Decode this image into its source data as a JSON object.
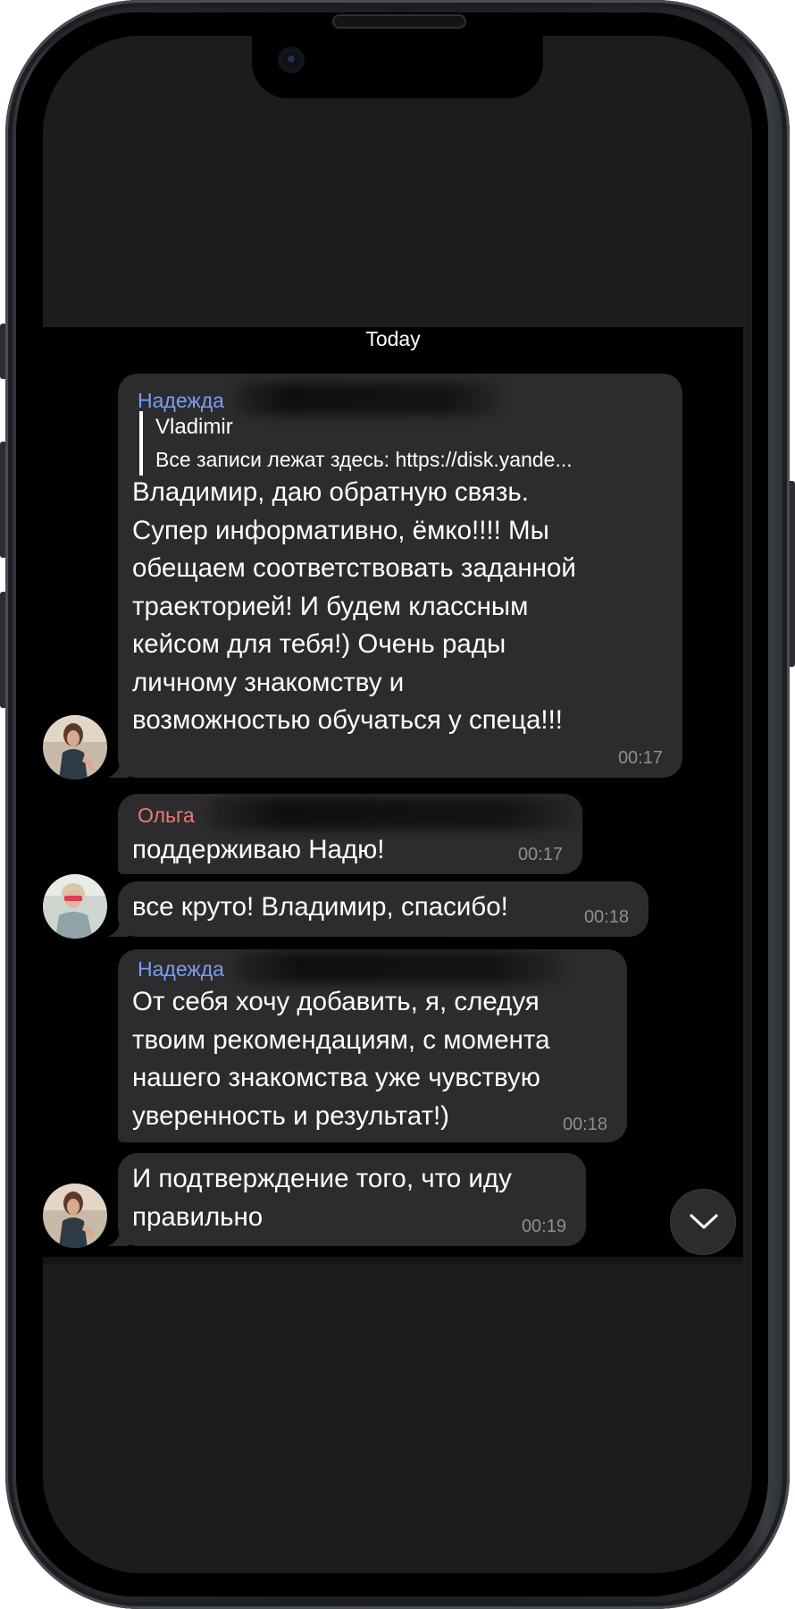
{
  "chat": {
    "day_separator": "Today",
    "messages": [
      {
        "sender": "Надежда",
        "sender_color": "#7a9cf2",
        "reply_to_name": "Vladimir",
        "reply_to_text": "Все записи лежат здесь: https://disk.yande...",
        "text": "Владимир, даю обратную связь.\nСупер информативно, ёмко!!!! Мы\nобещаем соответствовать заданной\nтраекторией! И будем классным\nкейсом для тебя!) Очень рады\nличному знакомству и\nвозможностью обучаться у спеца!!!",
        "time": "00:17"
      },
      {
        "sender": "Ольга",
        "sender_color": "#ec7a72",
        "text": "поддерживаю Надю!",
        "time": "00:17"
      },
      {
        "text": "все круто! Владимир, спасибо!",
        "time": "00:18"
      },
      {
        "sender": "Надежда",
        "sender_color": "#7a9cf2",
        "text": "От себя хочу добавить, я, следуя\nтвоим рекомендациям, с момента\nнашего знакомства уже чувствую\nуверенность и результат!)",
        "time": "00:18"
      },
      {
        "text": "И подтверждение того, что иду\nправильно",
        "time": "00:19"
      }
    ],
    "scroll_down_icon": "chevron-down-icon"
  }
}
